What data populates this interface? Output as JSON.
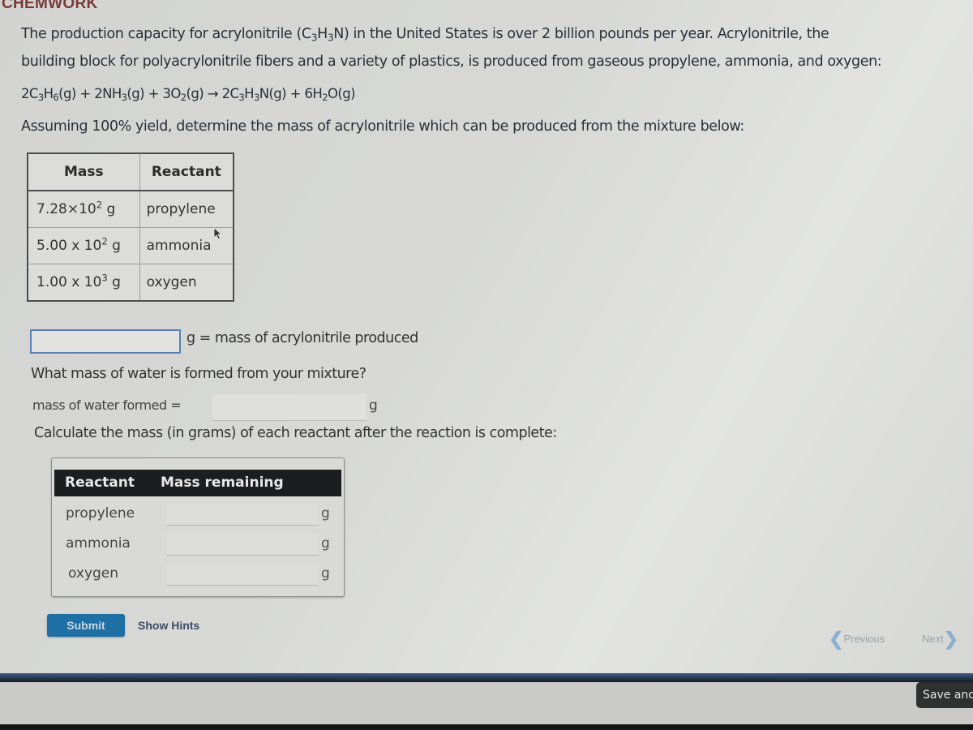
{
  "app": {
    "title": "CHEMWORK"
  },
  "problem": {
    "intro_line1_a": "The production capacity for acrylonitrile (C",
    "intro_line1_b": "H",
    "intro_line1_c": "N) in the United States is over 2 billion pounds per year. Acrylonitrile, the",
    "intro_line2": "building block for polyacrylonitrile fibers and a variety of plastics, is produced from gaseous propylene, ammonia, and oxygen:",
    "equation": {
      "t1": "2C",
      "t2": "H",
      "t3": "(g) + 2NH",
      "t4": "(g) + 3O",
      "t5": "(g) → 2C",
      "t6": "H",
      "t7": "N(g) + 6H",
      "t8": "O(g)",
      "sub_3": "3",
      "sub_6": "6",
      "sub_2": "2"
    },
    "assumption": "Assuming 100% yield, determine the mass of acrylonitrile which can be produced from the mixture below:"
  },
  "given_table": {
    "headers": [
      "Mass",
      "Reactant"
    ],
    "rows": [
      {
        "mass_base": "7.28×10",
        "exp": "2",
        "unit": " g",
        "reactant": "propylene"
      },
      {
        "mass_base": "5.00 x 10",
        "exp": "2",
        "unit": " g",
        "reactant": "ammonia"
      },
      {
        "mass_base": "1.00 x 10",
        "exp": "3",
        "unit": " g",
        "reactant": "oxygen"
      }
    ]
  },
  "questions": {
    "acrylonitrile": {
      "value": "",
      "label": "g = mass of acrylonitrile produced"
    },
    "water_question": "What mass of water is formed from your mixture?",
    "water": {
      "label": "mass of water formed =",
      "value": "",
      "unit": "g"
    },
    "remaining_question": "Calculate the mass (in grams) of each reactant after the reaction is complete:"
  },
  "remaining_table": {
    "headers": [
      "Reactant",
      "Mass remaining"
    ],
    "rows": [
      {
        "reactant": "propylene",
        "value": "",
        "unit": "g"
      },
      {
        "reactant": "ammonia",
        "value": "",
        "unit": "g"
      },
      {
        "reactant": "oxygen",
        "value": "",
        "unit": "g"
      }
    ]
  },
  "actions": {
    "submit": "Submit",
    "show_hints": "Show Hints",
    "previous": "Previous",
    "next": "Next",
    "save": "Save and"
  },
  "colors": {
    "title": "#7a3a36",
    "submit_bg": "#1e6fa3",
    "input_focus_border": "#5b7fb3",
    "table_header_bg": "#1c1d1f"
  }
}
